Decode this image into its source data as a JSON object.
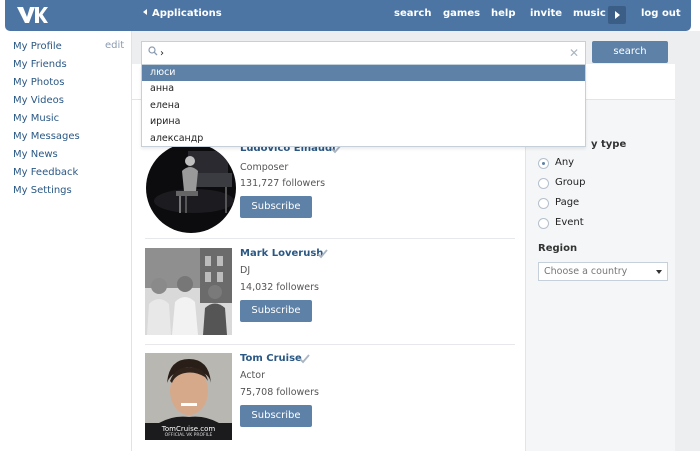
{
  "header": {
    "back_label": "Applications",
    "nav": [
      "search",
      "games",
      "help",
      "invite",
      "music"
    ],
    "logout": "log out",
    "colors": {
      "bar": "#4d75a3",
      "accent": "#5e81a8",
      "link": "#2a5885"
    }
  },
  "sidebar": {
    "edit_label": "edit",
    "items": [
      "My Profile",
      "My Friends",
      "My Photos",
      "My Videos",
      "My Music",
      "My Messages",
      "My News",
      "My Feedback",
      "My Settings"
    ]
  },
  "search": {
    "value": "›",
    "button_label": "search",
    "suggestions": [
      "люси",
      "анна",
      "елена",
      "ирина",
      "александр"
    ],
    "selected_index": 0
  },
  "results": [
    {
      "name": "Ludovico Einaudi",
      "type": "Composer",
      "followers": "131,727 followers",
      "button": "Subscribe",
      "verified": true
    },
    {
      "name": "Mark Loverush",
      "type": "DJ",
      "followers": "14,032 followers",
      "button": "Subscribe",
      "verified": true
    },
    {
      "name": "Tom Cruise",
      "type": "Actor",
      "followers": "75,708 followers",
      "button": "Subscribe",
      "verified": true,
      "avatar_caption_1": "TomCruise.com",
      "avatar_caption_2": "OFFICIAL VK PROFILE"
    }
  ],
  "filters": {
    "community_type_title": "y type",
    "options": [
      "Any",
      "Group",
      "Page",
      "Event"
    ],
    "selected": "Any",
    "region_title": "Region",
    "country_placeholder": "Choose a country"
  }
}
